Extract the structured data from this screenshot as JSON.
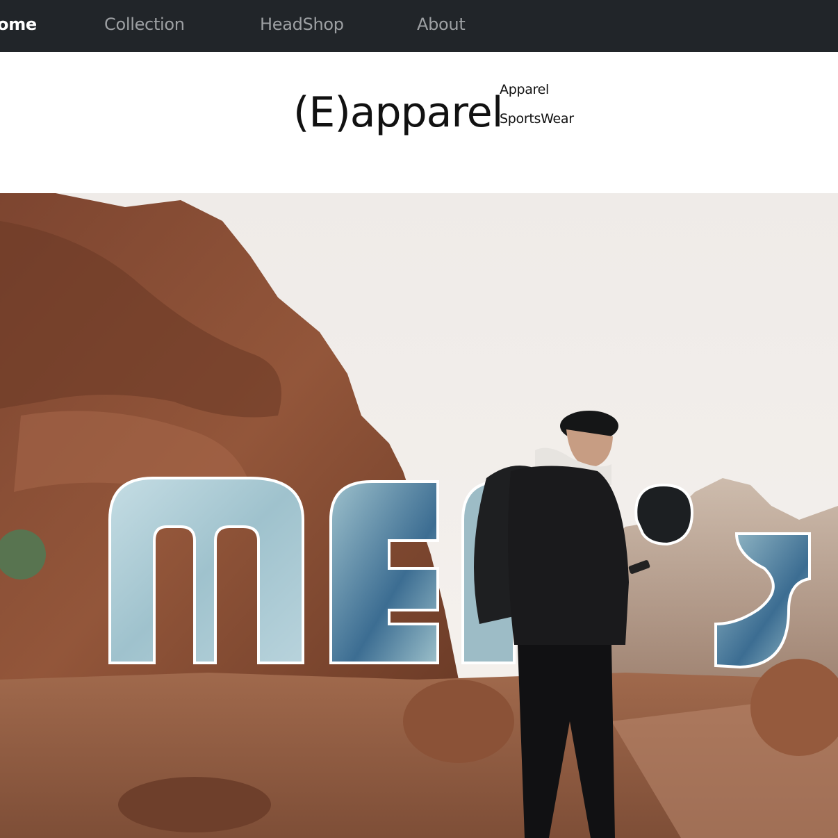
{
  "nav": {
    "items": [
      {
        "label": "ome",
        "active": true
      },
      {
        "label": "Collection",
        "active": false
      },
      {
        "label": "HeadShop",
        "active": false
      },
      {
        "label": "About",
        "active": false
      }
    ]
  },
  "brand": {
    "name": "(E)apparel",
    "sub_top": "Apparel",
    "sub_bottom": "SportsWear"
  },
  "hero": {
    "word": "MEN'S",
    "colors": {
      "sky": "#f1edea",
      "rock": "#8a4f34",
      "rock_dark": "#5a3020",
      "ground": "#9a6347",
      "marble": "#a9c8d2",
      "marble_dark": "#22313a",
      "jacket": "#1a1a1c"
    }
  }
}
